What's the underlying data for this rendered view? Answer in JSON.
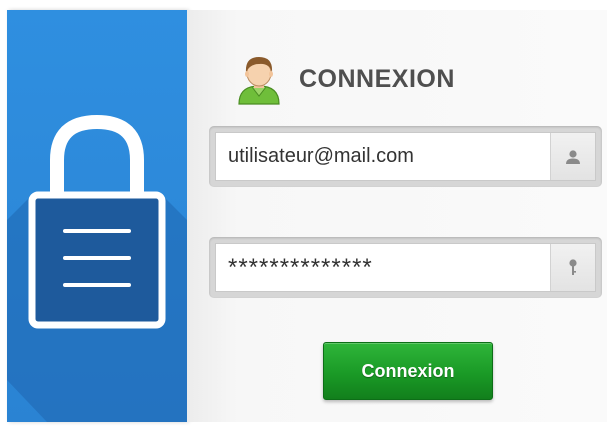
{
  "header": {
    "title": "CONNEXION",
    "icon": "user-avatar-icon"
  },
  "login_form": {
    "email": {
      "value": "utilisateur@mail.com",
      "icon": "user-icon"
    },
    "password": {
      "value": "**************",
      "icon": "key-icon"
    },
    "submit_label": "Connexion"
  },
  "decoration": {
    "icon": "padlock-icon"
  },
  "colors": {
    "panel_blue": "#2a86d8",
    "panel_shadow": "#1f64ad",
    "button_green": "#1a9a26",
    "title_gray": "#4f4f4f"
  }
}
